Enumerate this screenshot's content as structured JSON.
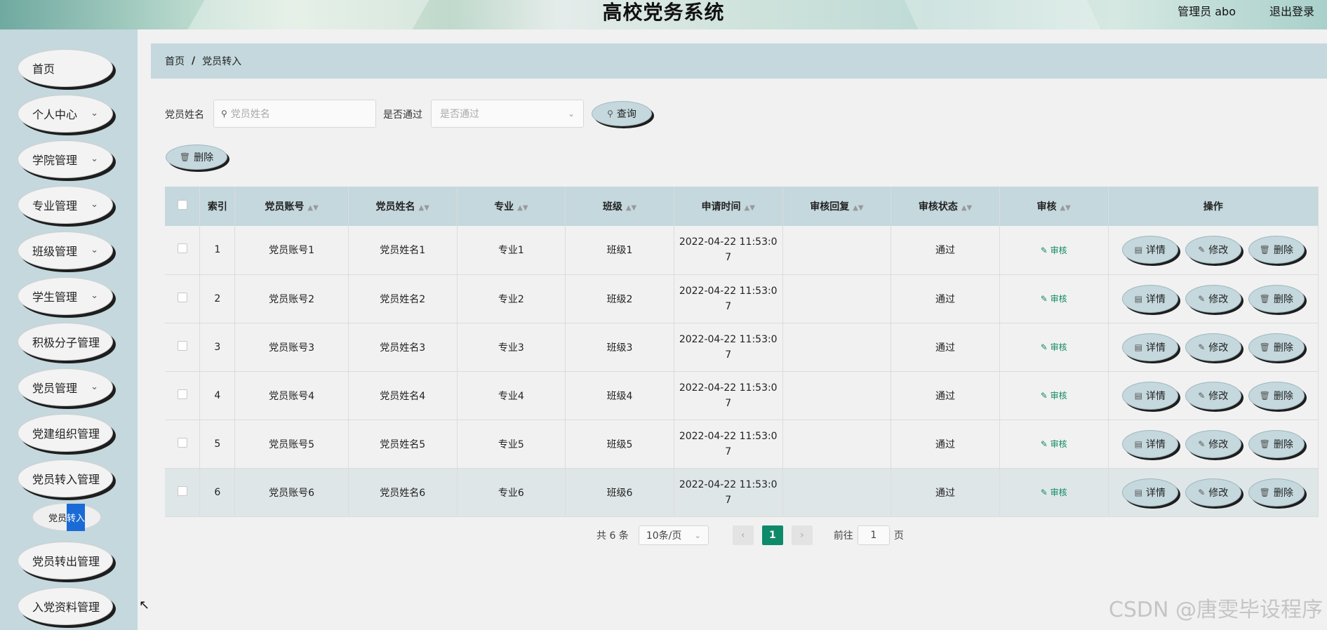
{
  "header": {
    "title": "高校党务系统",
    "admin": "管理员 abo",
    "logout": "退出登录"
  },
  "sidebar": {
    "items": [
      {
        "label": "首页",
        "has_sub": false
      },
      {
        "label": "个人中心",
        "has_sub": true
      },
      {
        "label": "学院管理",
        "has_sub": true
      },
      {
        "label": "专业管理",
        "has_sub": true
      },
      {
        "label": "班级管理",
        "has_sub": true
      },
      {
        "label": "学生管理",
        "has_sub": true
      },
      {
        "label": "积极分子管理",
        "has_sub": false
      },
      {
        "label": "党员管理",
        "has_sub": true
      },
      {
        "label": "党建组织管理",
        "has_sub": false
      },
      {
        "label": "党员转入管理",
        "has_sub": false
      },
      {
        "label": "党员转出管理",
        "has_sub": false
      },
      {
        "label": "入党资料管理",
        "has_sub": false
      }
    ],
    "sub_item": {
      "label_a": "党员",
      "label_b": "转入"
    }
  },
  "breadcrumb": {
    "home": "首页",
    "sep": "/",
    "current": "党员转入"
  },
  "search": {
    "name_label": "党员姓名",
    "name_placeholder": "党员姓名",
    "pass_label": "是否通过",
    "pass_placeholder": "是否通过",
    "query": "查询"
  },
  "toolbar": {
    "delete": "删除"
  },
  "table": {
    "headers": {
      "index": "索引",
      "account": "党员账号",
      "name": "党员姓名",
      "major": "专业",
      "class": "班级",
      "time": "申请时间",
      "reply": "审核回复",
      "status": "审核状态",
      "audit": "审核",
      "ops": "操作"
    },
    "rows": [
      {
        "index": "1",
        "account": "党员账号1",
        "name": "党员姓名1",
        "major": "专业1",
        "class": "班级1",
        "time_a": "2022-04-22 11:53:0",
        "time_b": "7",
        "reply": "",
        "status": "通过",
        "audit": "审核"
      },
      {
        "index": "2",
        "account": "党员账号2",
        "name": "党员姓名2",
        "major": "专业2",
        "class": "班级2",
        "time_a": "2022-04-22 11:53:0",
        "time_b": "7",
        "reply": "",
        "status": "通过",
        "audit": "审核"
      },
      {
        "index": "3",
        "account": "党员账号3",
        "name": "党员姓名3",
        "major": "专业3",
        "class": "班级3",
        "time_a": "2022-04-22 11:53:0",
        "time_b": "7",
        "reply": "",
        "status": "通过",
        "audit": "审核"
      },
      {
        "index": "4",
        "account": "党员账号4",
        "name": "党员姓名4",
        "major": "专业4",
        "class": "班级4",
        "time_a": "2022-04-22 11:53:0",
        "time_b": "7",
        "reply": "",
        "status": "通过",
        "audit": "审核"
      },
      {
        "index": "5",
        "account": "党员账号5",
        "name": "党员姓名5",
        "major": "专业5",
        "class": "班级5",
        "time_a": "2022-04-22 11:53:0",
        "time_b": "7",
        "reply": "",
        "status": "通过",
        "audit": "审核"
      },
      {
        "index": "6",
        "account": "党员账号6",
        "name": "党员姓名6",
        "major": "专业6",
        "class": "班级6",
        "time_a": "2022-04-22 11:53:0",
        "time_b": "7",
        "reply": "",
        "status": "通过",
        "audit": "审核"
      }
    ],
    "actions": {
      "detail": "详情",
      "edit": "修改",
      "delete": "删除"
    }
  },
  "pagination": {
    "total": "共 6 条",
    "size": "10条/页",
    "current": "1",
    "goto": "前往",
    "goto_value": "1",
    "page": "页"
  },
  "watermark": "CSDN @唐雯毕设程序"
}
